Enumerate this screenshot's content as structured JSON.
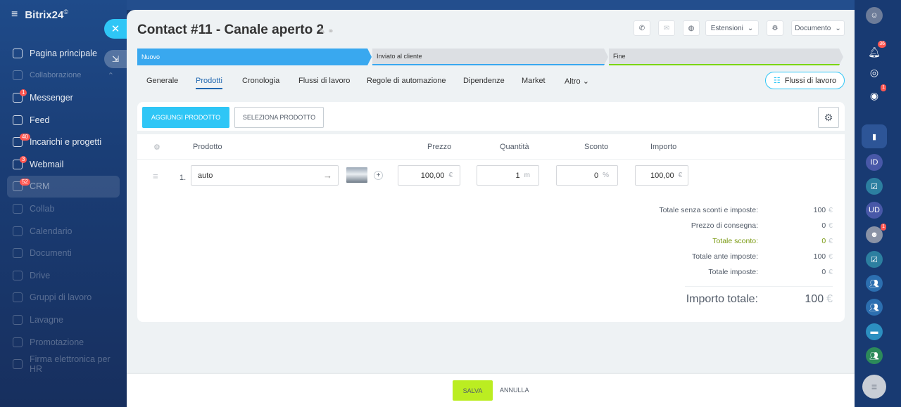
{
  "app": {
    "logo": "Bitrix24",
    "logo_mark": "©"
  },
  "sidebar": {
    "items": [
      {
        "label": "Pagina principale",
        "badge": ""
      },
      {
        "label": "Collaborazione",
        "badge": ""
      },
      {
        "label": "Messenger",
        "badge": "1"
      },
      {
        "label": "Feed",
        "badge": ""
      },
      {
        "label": "Incarichi e progetti",
        "badge": "40"
      },
      {
        "label": "Webmail",
        "badge": "3"
      },
      {
        "label": "CRM",
        "badge": "52"
      },
      {
        "label": "Collab",
        "badge": ""
      },
      {
        "label": "Calendario",
        "badge": ""
      },
      {
        "label": "Documenti",
        "badge": ""
      },
      {
        "label": "Drive",
        "badge": ""
      },
      {
        "label": "Gruppi di lavoro",
        "badge": ""
      },
      {
        "label": "Lavagne",
        "badge": ""
      },
      {
        "label": "Promotazione",
        "badge": ""
      },
      {
        "label": "Firma elettronica per HR",
        "badge": ""
      }
    ]
  },
  "header": {
    "title": "Contact #11 - Canale aperto 2",
    "extensions_label": "Estensioni",
    "document_label": "Documento"
  },
  "pipeline": {
    "stages": [
      {
        "label": "Nuovo"
      },
      {
        "label": "Inviato al cliente"
      },
      {
        "label": "Fine"
      }
    ]
  },
  "tabs": [
    {
      "label": "Generale"
    },
    {
      "label": "Prodotti"
    },
    {
      "label": "Cronologia"
    },
    {
      "label": "Flussi di lavoro"
    },
    {
      "label": "Regole di automazione"
    },
    {
      "label": "Dipendenze"
    },
    {
      "label": "Market"
    },
    {
      "label": "Altro"
    }
  ],
  "flussi_button": "Flussi di lavoro",
  "products": {
    "add_label": "AGGIUNGI PRODOTTO",
    "select_label": "SELEZIONA PRODOTTO",
    "columns": {
      "product": "Prodotto",
      "price": "Prezzo",
      "quantity": "Quantità",
      "discount": "Sconto",
      "amount": "Importo"
    },
    "rows": [
      {
        "index": "1.",
        "name": "auto",
        "price": "100,00",
        "currency": "€",
        "quantity": "1",
        "unit": "m",
        "discount": "0",
        "discount_unit": "%",
        "amount": "100,00"
      }
    ]
  },
  "totals": {
    "rows": [
      {
        "label": "Totale senza sconti e imposte:",
        "value": "100"
      },
      {
        "label": "Prezzo di consegna:",
        "value": "0"
      },
      {
        "label": "Totale sconto:",
        "value": "0"
      },
      {
        "label": "Totale ante imposte:",
        "value": "100"
      },
      {
        "label": "Totale imposte:",
        "value": "0"
      }
    ],
    "total_label": "Importo totale:",
    "total_value": "100",
    "currency": "€"
  },
  "footer": {
    "save_label": "SALVA",
    "cancel_label": "ANNULLA"
  },
  "right_rail": {
    "badges": [
      "36",
      "1",
      "1"
    ],
    "labels": [
      "ID",
      "UD"
    ]
  },
  "colors": {
    "accent": "#2fc6f6",
    "save": "#bbed21",
    "active_tab": "#2067b0",
    "discount_green": "#7a9a12"
  }
}
